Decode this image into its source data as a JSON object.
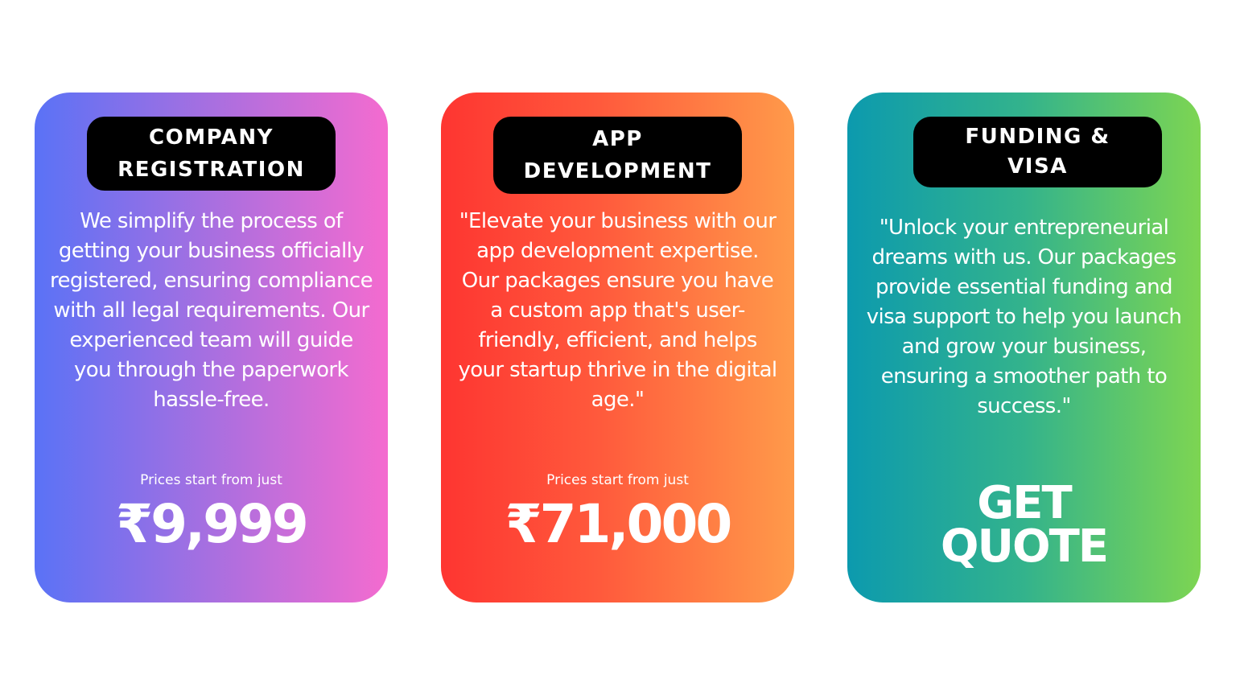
{
  "cards": [
    {
      "title": "COMPANY\nREGISTRATION",
      "description": "We simplify the process of getting your business officially registered, ensuring compliance with all legal requirements. Our experienced team will guide you through the paperwork hassle-free.",
      "price_label": "Prices start from just",
      "price": "₹9,999",
      "gradient": [
        "#5a72f6",
        "#f46bcf"
      ]
    },
    {
      "title": "APP\nDEVELOPMENT",
      "description": "\"Elevate your business with our app development expertise. Our packages ensure you have a custom app that's user-friendly, efficient, and helps your startup thrive in the digital age.\"",
      "price_label": "Prices start from just",
      "price": "₹71,000",
      "gradient": [
        "#fe3531",
        "#ff9a4a"
      ]
    },
    {
      "title": "FUNDING &\nVISA",
      "description": "\"Unlock your entrepreneurial dreams with us. Our packages provide essential funding and visa support to help you launch and grow your business, ensuring a smoother path to success.\"",
      "cta": "GET\nQUOTE",
      "gradient": [
        "#0c9aae",
        "#7dd552"
      ]
    }
  ]
}
